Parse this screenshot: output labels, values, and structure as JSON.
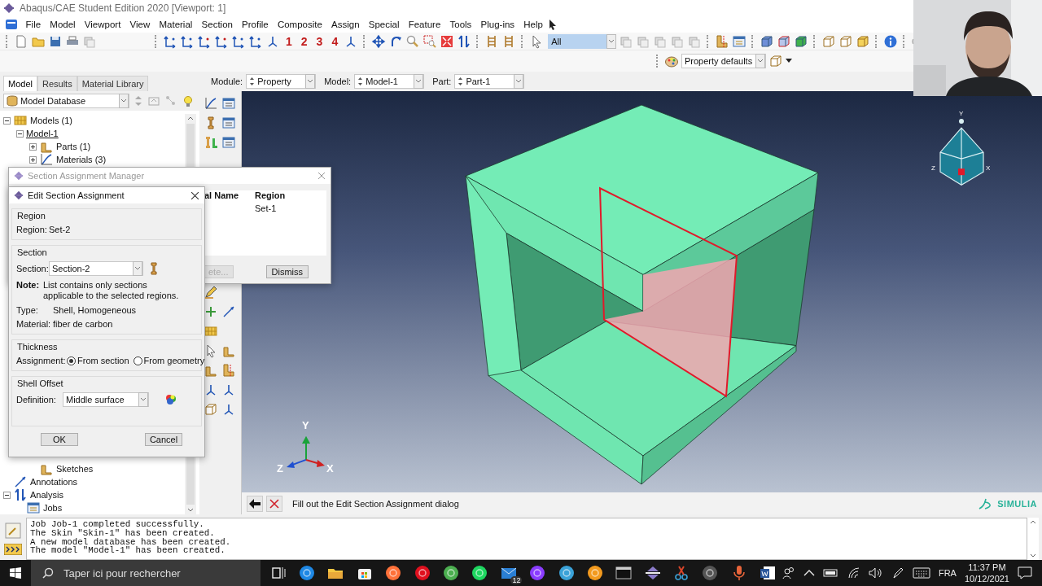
{
  "window": {
    "title": "Abaqus/CAE Student Edition 2020 [Viewport: 1]"
  },
  "menu": [
    "File",
    "Model",
    "Viewport",
    "View",
    "Material",
    "Section",
    "Profile",
    "Composite",
    "Assign",
    "Special",
    "Feature",
    "Tools",
    "Plug-ins",
    "Help"
  ],
  "toolbar": {
    "view_numbers": [
      "1",
      "2",
      "3",
      "4"
    ],
    "selection_filter": "All",
    "render_style": "Property defaults"
  },
  "context_bar": [
    {
      "label": "Module:",
      "value": "Property"
    },
    {
      "label": "Model:",
      "value": "Model-1"
    },
    {
      "label": "Part:",
      "value": "Part-1"
    }
  ],
  "model_tree": {
    "tabs": [
      {
        "label": "Model",
        "selected": true
      },
      {
        "label": "Results",
        "selected": false
      },
      {
        "label": "Material Library",
        "selected": false
      }
    ],
    "database": "Model Database",
    "items": [
      {
        "label": "Models (1)",
        "expanded": true,
        "children": [
          {
            "label": "Model-1",
            "expanded": true,
            "current": true,
            "children": [
              {
                "label": "Parts (1)",
                "expanded": false
              },
              {
                "label": "Materials (3)",
                "expanded": false
              },
              {
                "label": "Sketches"
              }
            ]
          }
        ]
      },
      {
        "label": "Annotations"
      },
      {
        "label": "Analysis",
        "expanded": true,
        "children": [
          {
            "label": "Jobs"
          }
        ]
      }
    ]
  },
  "viewport": {
    "triad": [
      "Y",
      "Z",
      "X"
    ],
    "view_cube": [
      "Y",
      "Z",
      "X"
    ]
  },
  "section_manager": {
    "title": "Section Assignment Manager",
    "columns": [
      "al Name",
      "Region"
    ],
    "rows": [
      {
        "region": "Set-1"
      }
    ],
    "buttons": [
      {
        "label": "ete...",
        "disabled": true
      },
      {
        "label": "Dismiss",
        "disabled": false
      }
    ]
  },
  "edit_dialog": {
    "title": "Edit Section Assignment",
    "region": {
      "legend": "Region",
      "label": "Region:",
      "value": "Set-2"
    },
    "section": {
      "legend": "Section",
      "label": "Section:",
      "value": "Section-2",
      "note_label": "Note:",
      "note": "List contains only sections applicable to the selected regions.",
      "details": [
        {
          "label": "Type:",
          "value": "Shell, Homogeneous"
        },
        {
          "label": "Material:",
          "value": "fiber de carbon"
        }
      ]
    },
    "thickness": {
      "legend": "Thickness",
      "label": "Assignment:",
      "options": [
        {
          "label": "From section",
          "selected": true
        },
        {
          "label": "From geometry",
          "selected": false
        }
      ]
    },
    "shell_offset": {
      "legend": "Shell Offset",
      "label": "Definition:",
      "value": "Middle surface"
    },
    "buttons": [
      "OK",
      "Cancel"
    ]
  },
  "prompt": "Fill out the Edit Section Assignment dialog",
  "brand": "SIMULIA",
  "messages": [
    "Job Job-1 completed successfully.",
    "The Skin \"Skin-1\" has been created.",
    "A new model database has been created.",
    "The model \"Model-1\" has been created."
  ],
  "taskbar": {
    "search_placeholder": "Taper ici pour rechercher",
    "mail_badge": "12",
    "language": "FRA",
    "time": "11:37 PM",
    "date": "10/12/2021"
  }
}
